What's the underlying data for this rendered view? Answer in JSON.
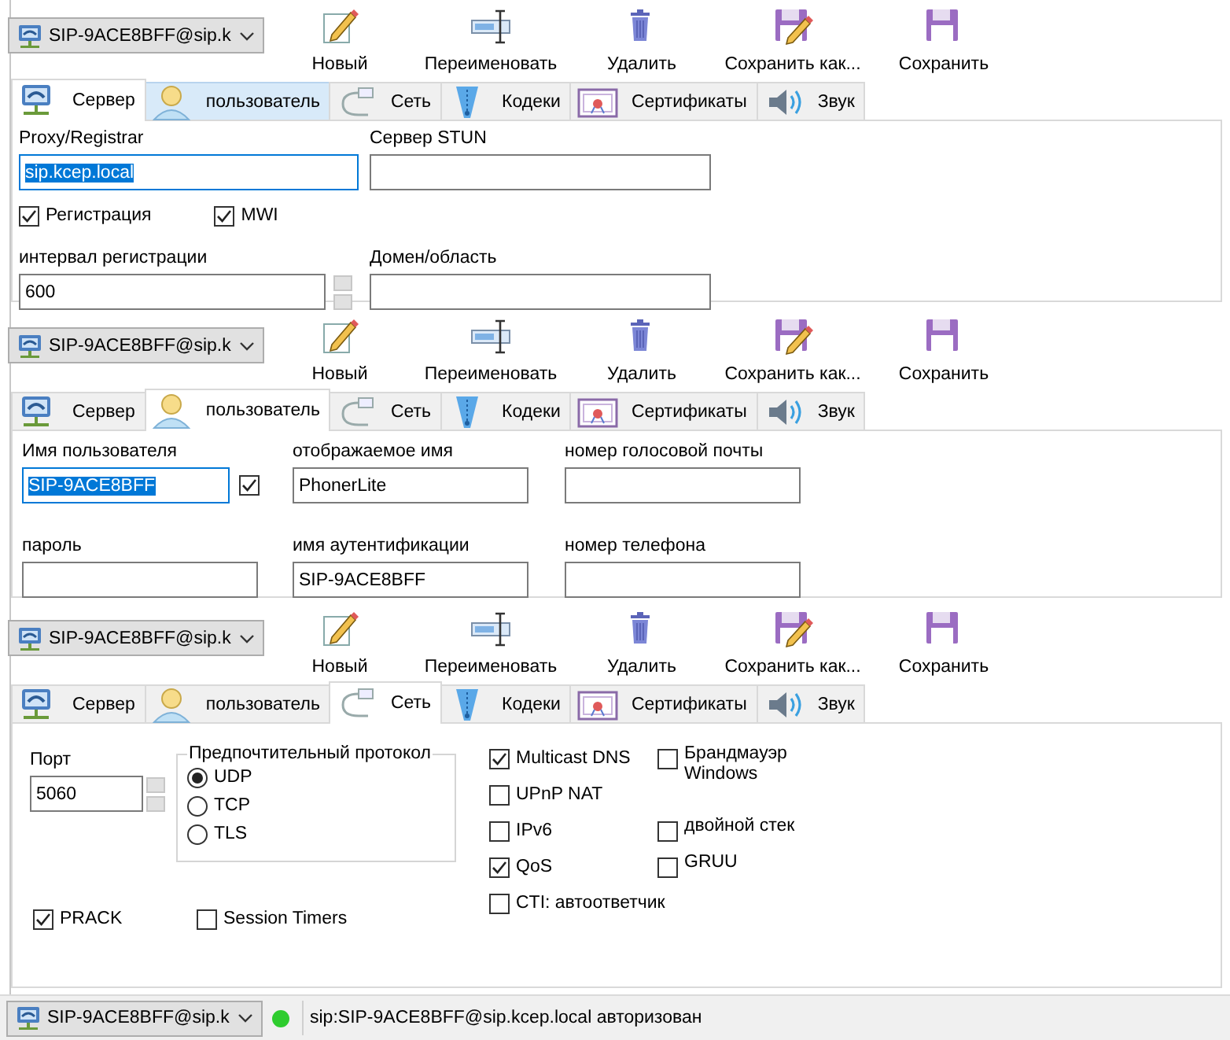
{
  "panels": [
    {
      "kind": "server",
      "account": "SIP-9ACE8BFF@sip.k",
      "toolbar": [
        {
          "label": "Новый"
        },
        {
          "label": "Переименовать"
        },
        {
          "label": "Удалить"
        },
        {
          "label": "Сохранить как..."
        },
        {
          "label": "Сохранить"
        }
      ],
      "tabs": [
        {
          "label": "Сервер",
          "selected": true
        },
        {
          "label": "пользователь",
          "selected": false,
          "hovered": true
        },
        {
          "label": "Сеть",
          "selected": false
        },
        {
          "label": "Кодеки",
          "selected": false
        },
        {
          "label": "Сертификаты",
          "selected": false
        },
        {
          "label": "Звук",
          "selected": false
        }
      ],
      "proxy": {
        "label": "Proxy/Registrar",
        "value": "sip.kcep.local",
        "highlighted": true
      },
      "stun": {
        "label": "Сервер STUN"
      },
      "registration": {
        "label": "Регистрация",
        "checked": true
      },
      "mwi": {
        "label": "MWI",
        "checked": true
      },
      "interval": {
        "label": "интервал регистрации",
        "value": "600"
      },
      "domain": {
        "label": "Домен/область"
      }
    },
    {
      "kind": "user",
      "account": "SIP-9ACE8BFF@sip.k",
      "toolbar": [
        {
          "label": "Новый"
        },
        {
          "label": "Переименовать"
        },
        {
          "label": "Удалить"
        },
        {
          "label": "Сохранить как..."
        },
        {
          "label": "Сохранить"
        }
      ],
      "tabs": [
        {
          "label": "Сервер",
          "selected": false
        },
        {
          "label": "пользователь",
          "selected": true
        },
        {
          "label": "Сеть",
          "selected": false
        },
        {
          "label": "Кодеки",
          "selected": false
        },
        {
          "label": "Сертификаты",
          "selected": false
        },
        {
          "label": "Звук",
          "selected": false
        }
      ],
      "fields": [
        {
          "label": "Имя пользователя",
          "value": "SIP-9ACE8BFF",
          "highlighted": true,
          "checked": true
        },
        {
          "label": "отображаемое имя",
          "value": "PhonerLite"
        },
        {
          "label": "номер голосовой почты"
        },
        {
          "label": "пароль"
        },
        {
          "label": "имя аутентификации",
          "value": "SIP-9ACE8BFF"
        },
        {
          "label": "номер телефона"
        }
      ]
    },
    {
      "kind": "network",
      "account": "SIP-9ACE8BFF@sip.k",
      "toolbar": [
        {
          "label": "Новый"
        },
        {
          "label": "Переименовать"
        },
        {
          "label": "Удалить"
        },
        {
          "label": "Сохранить как..."
        },
        {
          "label": "Сохранить"
        }
      ],
      "tabs": [
        {
          "label": "Сервер",
          "selected": false
        },
        {
          "label": "пользователь",
          "selected": false
        },
        {
          "label": "Сеть",
          "selected": true
        },
        {
          "label": "Кодеки",
          "selected": false
        },
        {
          "label": "Сертификаты",
          "selected": false
        },
        {
          "label": "Звук",
          "selected": false
        }
      ],
      "port": {
        "label": "Порт",
        "value": "5060"
      },
      "protocol": {
        "label": "Предпочтительный протокол",
        "options": [
          {
            "label": "UDP",
            "selected": true
          },
          {
            "label": "TCP",
            "selected": false
          },
          {
            "label": "TLS",
            "selected": false
          }
        ]
      },
      "option_rows": [
        [
          {
            "label": "Multicast DNS",
            "checked": true
          },
          {
            "label": "Брандмауэр Windows",
            "checked": false
          }
        ],
        [
          {
            "label": "UPnP NAT",
            "checked": false
          }
        ],
        [
          {
            "label": "IPv6",
            "checked": false
          },
          {
            "label": "двойной стек",
            "checked": false
          }
        ],
        [
          {
            "label": "QoS",
            "checked": true
          },
          {
            "label": "GRUU",
            "checked": false
          }
        ],
        [
          {
            "label": "CTI: автоответчик",
            "checked": false
          }
        ]
      ],
      "bottom_options": [
        {
          "label": "PRACK",
          "checked": true
        },
        {
          "label": "Session Timers",
          "checked": false
        }
      ]
    }
  ],
  "status_bar": {
    "account": "SIP-9ACE8BFF@sip.k",
    "connected": true,
    "text": "sip:SIP-9ACE8BFF@sip.kcep.local авторизован"
  }
}
